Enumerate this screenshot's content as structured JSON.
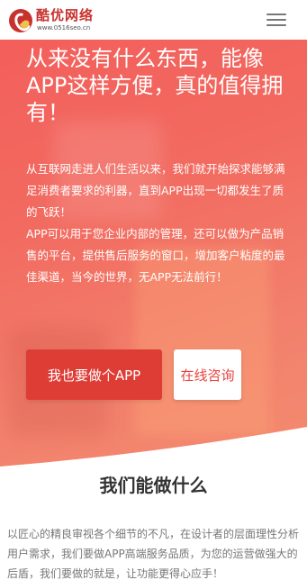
{
  "header": {
    "logo_name": "酷优网络",
    "logo_url": "www.0516seo.cn",
    "menu_icon": "hamburger-menu-icon"
  },
  "hero": {
    "title": "从来没有什么东西，能像APP这样方便，真的值得拥有！",
    "desc_1": "从互联网走进人们生活以来，我们就开始探求能够满足消费者要求的利器，直到APP出现一切都发生了质的飞跃！",
    "desc_2": "APP可以用于您企业内部的管理，还可以做为产品销售的平台，提供售后服务的窗口，增加客户粘度的最佳渠道，当今的世界，无APP无法前行！",
    "primary_button": "我也要做个APP",
    "secondary_button": "在线咨询"
  },
  "section": {
    "title": "我们能做什么",
    "desc": "以匠心的精良审视各个细节的不凡，在设计者的层面理性分析用户需求，我们要做APP高端服务品质，为您的运营做强大的后盾，我们要做的就是，让功能更得心应手！"
  },
  "colors": {
    "brand_red": "#c8322e",
    "hero_start": "#f35f5b",
    "hero_end": "#f48c70",
    "button_red": "#de3d36"
  }
}
